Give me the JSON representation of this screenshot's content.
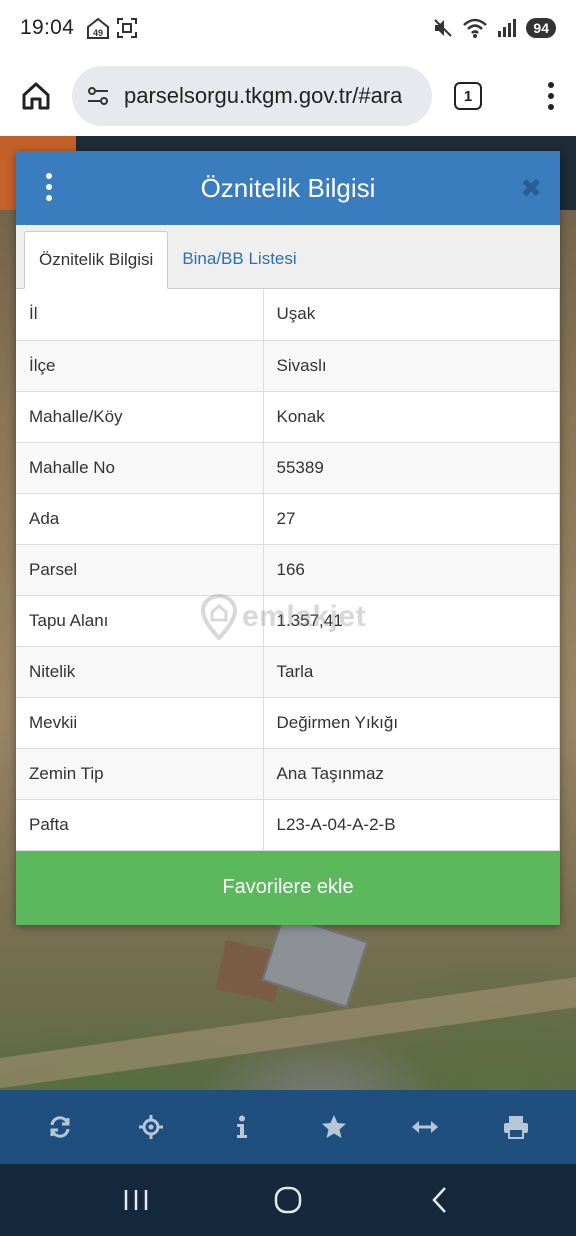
{
  "status_bar": {
    "time": "19:04",
    "notif_count": "49",
    "battery": "94",
    "icons": [
      "photo-notification-icon",
      "screen-capture-icon",
      "mute-icon",
      "wifi-icon",
      "signal-icon",
      "battery-icon"
    ]
  },
  "browser": {
    "url": "parselsorgu.tkgm.gov.tr/#ara",
    "tab_count": "1"
  },
  "panel": {
    "title": "Öznitelik Bilgisi",
    "close_label": "✖",
    "tabs": [
      {
        "label": "Öznitelik Bilgisi",
        "active": true
      },
      {
        "label": "Bina/BB Listesi",
        "active": false
      }
    ],
    "rows": [
      {
        "key": "İl",
        "value": "Uşak"
      },
      {
        "key": "İlçe",
        "value": "Sivaslı"
      },
      {
        "key": "Mahalle/Köy",
        "value": "Konak"
      },
      {
        "key": "Mahalle No",
        "value": "55389"
      },
      {
        "key": "Ada",
        "value": "27"
      },
      {
        "key": "Parsel",
        "value": "166"
      },
      {
        "key": "Tapu Alanı",
        "value": "1.357,41"
      },
      {
        "key": "Nitelik",
        "value": "Tarla"
      },
      {
        "key": "Mevkii",
        "value": "Değirmen Yıkığı"
      },
      {
        "key": "Zemin Tip",
        "value": "Ana Taşınmaz"
      },
      {
        "key": "Pafta",
        "value": "L23-A-04-A-2-B"
      }
    ],
    "favorite_button": "Favorilere ekle"
  },
  "watermark": "emlakjet",
  "toolbar": {
    "icons": [
      "refresh-icon",
      "locate-icon",
      "info-icon",
      "star-icon",
      "measure-icon",
      "print-icon"
    ]
  },
  "colors": {
    "header_blue": "#3a7dbf",
    "toolbar_blue": "#1e4f7e",
    "favorite_green": "#5cb85c",
    "nav_dark": "#16283c"
  }
}
